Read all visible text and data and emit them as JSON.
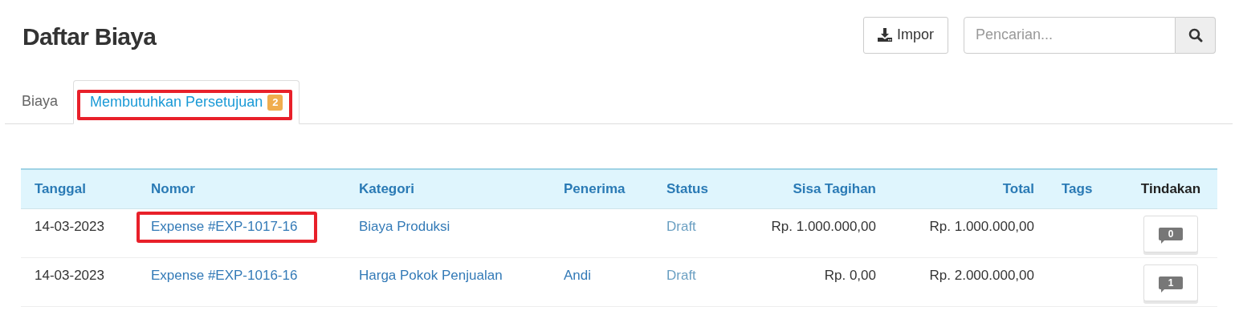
{
  "title": "Daftar Biaya",
  "import_button": "Impor",
  "search": {
    "placeholder": "Pencarian..."
  },
  "tabs": [
    {
      "label": "Biaya",
      "selected": false,
      "highlighted": false
    },
    {
      "label": "Membutuhkan Persetujuan",
      "badge": "2",
      "selected": true,
      "highlighted": true
    }
  ],
  "table": {
    "columns": [
      {
        "label": "Tanggal"
      },
      {
        "label": "Nomor"
      },
      {
        "label": "Kategori"
      },
      {
        "label": "Penerima"
      },
      {
        "label": "Status"
      },
      {
        "label": "Sisa Tagihan"
      },
      {
        "label": "Total"
      },
      {
        "label": "Tags"
      },
      {
        "label": "Tindakan"
      }
    ],
    "rows": [
      {
        "date": "14-03-2023",
        "number": "Expense #EXP-1017-16",
        "highlighted": true,
        "category": "Biaya Produksi",
        "status": "Draft",
        "balance": "Rp. 1.000.000,00",
        "total": "Rp. 1.000.000,00",
        "comments": "0"
      },
      {
        "date": "14-03-2023",
        "number": "Expense #EXP-1016-16",
        "highlighted": false,
        "category": "Harga Pokok Penjualan",
        "payee": "Andi",
        "status": "Draft",
        "balance": "Rp. 0,00",
        "total": "Rp. 2.000.000,00",
        "comments": "1"
      }
    ]
  }
}
